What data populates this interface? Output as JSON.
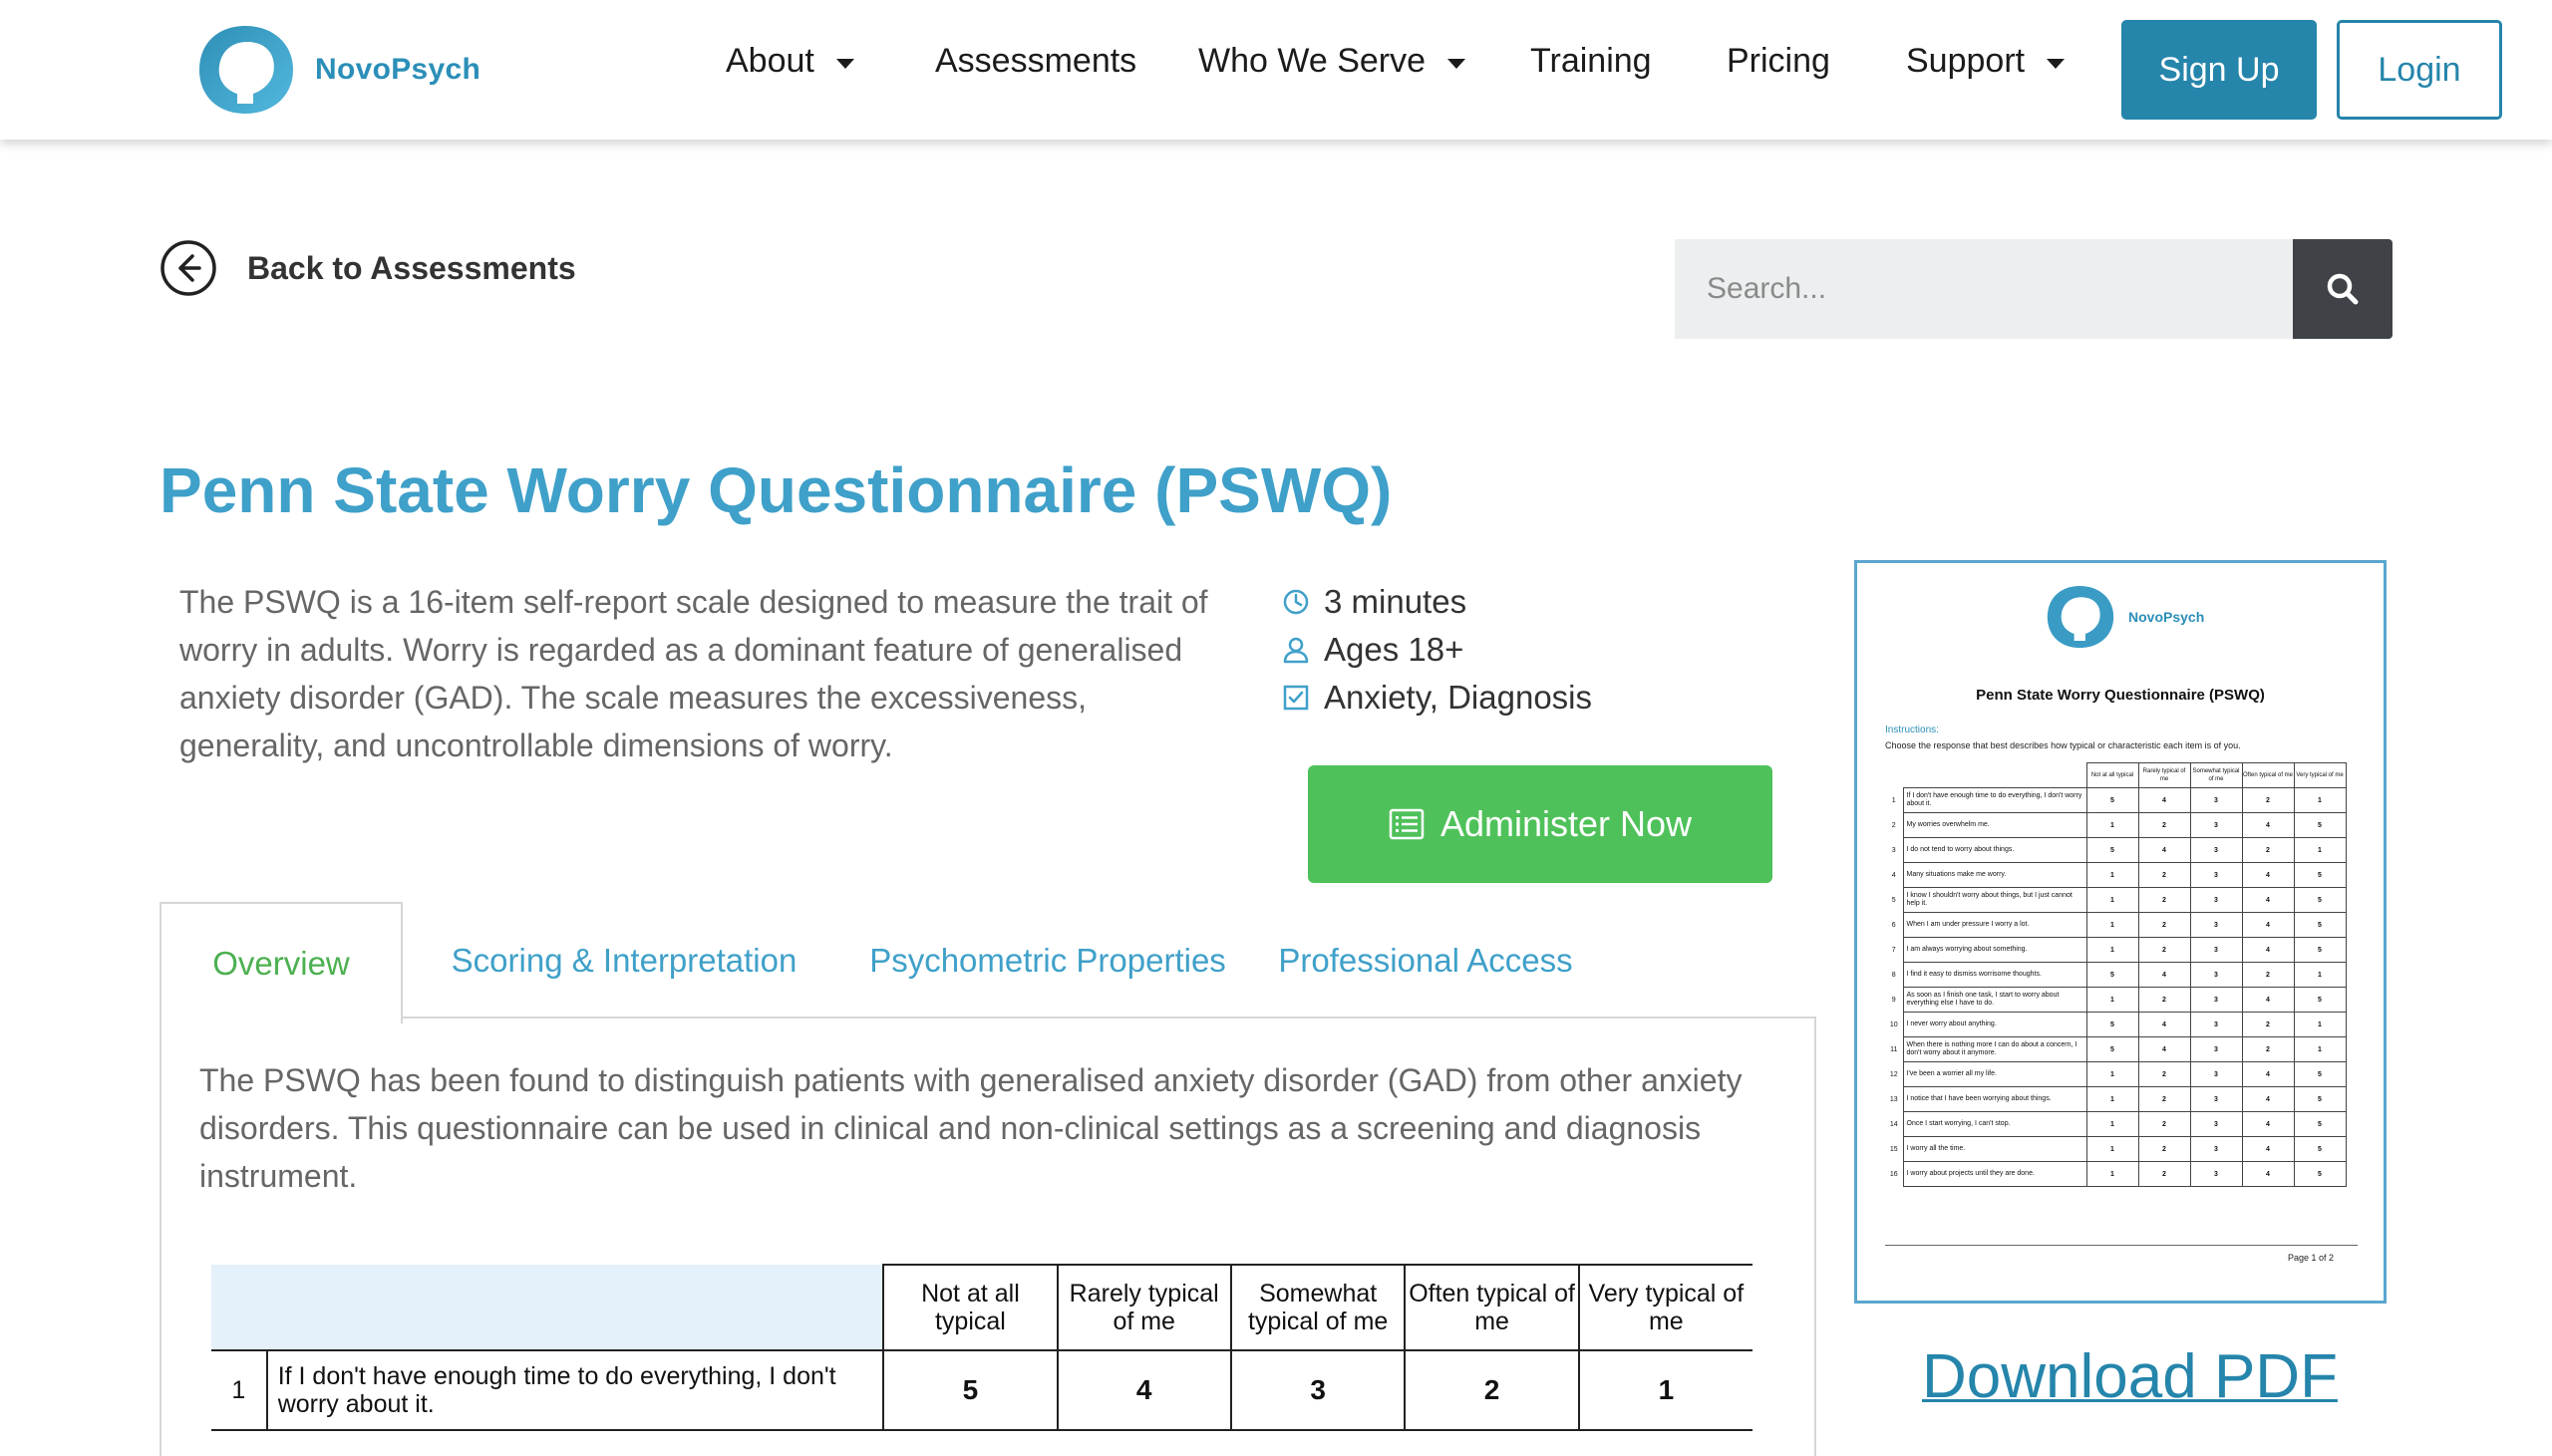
{
  "brand": {
    "name": "NovoPsych",
    "color": "#2b8fb8"
  },
  "nav": {
    "items": [
      {
        "label": "About",
        "dropdown": true
      },
      {
        "label": "Assessments",
        "dropdown": false
      },
      {
        "label": "Who We Serve",
        "dropdown": true
      },
      {
        "label": "Training",
        "dropdown": false
      },
      {
        "label": "Pricing",
        "dropdown": false
      },
      {
        "label": "Support",
        "dropdown": true
      }
    ],
    "signup_label": "Sign Up",
    "login_label": "Login"
  },
  "back_label": "Back to Assessments",
  "search": {
    "placeholder": "Search..."
  },
  "page_title": "Penn State Worry Questionnaire (PSWQ)",
  "description": "The PSWQ is a 16-item self-report scale designed to measure the trait of worry in adults. Worry is regarded as a dominant feature of generalised anxiety disorder (GAD). The scale measures the excessiveness, generality, and uncontrollable dimensions of worry.",
  "meta": {
    "duration": "3 minutes",
    "ages": "Ages 18+",
    "category": "Anxiety, Diagnosis"
  },
  "administer_label": "Administer Now",
  "tabs": [
    {
      "label": "Overview",
      "active": true
    },
    {
      "label": "Scoring & Interpretation",
      "active": false
    },
    {
      "label": "Psychometric Properties",
      "active": false
    },
    {
      "label": "Professional Access",
      "active": false
    }
  ],
  "overview_text": "The PSWQ has been found to distinguish patients with generalised anxiety disorder (GAD) from other anxiety disorders. This questionnaire can be used in clinical and non-clinical settings as a screening and diagnosis instrument.",
  "sample_table": {
    "headers": [
      "Not at all typical",
      "Rarely typical of me",
      "Somewhat typical of me",
      "Often typical of me",
      "Very typical of me"
    ],
    "rows": [
      {
        "num": "1",
        "text": "If I don't have enough time to do everything, I don't worry about it.",
        "scores": [
          "5",
          "4",
          "3",
          "2",
          "1"
        ]
      }
    ]
  },
  "preview": {
    "brand": "NovoPsych",
    "title": "Penn State Worry Questionnaire  (PSWQ)",
    "instructions_label": "Instructions:",
    "instructions": "Choose the response that best describes how typical or characteristic each item is of you.",
    "headers": [
      "Not at all typical",
      "Rarely typical of me",
      "Somewhat typical of me",
      "Often typical of me",
      "Very typical of me"
    ],
    "items": [
      {
        "n": "1",
        "t": "If I don't have enough time to do everything, I don't worry about it.",
        "s": [
          "5",
          "4",
          "3",
          "2",
          "1"
        ]
      },
      {
        "n": "2",
        "t": "My worries overwhelm me.",
        "s": [
          "1",
          "2",
          "3",
          "4",
          "5"
        ]
      },
      {
        "n": "3",
        "t": "I do not tend to worry about things.",
        "s": [
          "5",
          "4",
          "3",
          "2",
          "1"
        ]
      },
      {
        "n": "4",
        "t": "Many situations make me worry.",
        "s": [
          "1",
          "2",
          "3",
          "4",
          "5"
        ]
      },
      {
        "n": "5",
        "t": "I know I shouldn't worry about things, but I just cannot help it.",
        "s": [
          "1",
          "2",
          "3",
          "4",
          "5"
        ]
      },
      {
        "n": "6",
        "t": "When I am under pressure I worry a lot.",
        "s": [
          "1",
          "2",
          "3",
          "4",
          "5"
        ]
      },
      {
        "n": "7",
        "t": "I am always worrying about something.",
        "s": [
          "1",
          "2",
          "3",
          "4",
          "5"
        ]
      },
      {
        "n": "8",
        "t": "I find it easy to dismiss worrisome thoughts.",
        "s": [
          "5",
          "4",
          "3",
          "2",
          "1"
        ]
      },
      {
        "n": "9",
        "t": "As soon as I finish one task, I start to worry about everything else I have to do.",
        "s": [
          "1",
          "2",
          "3",
          "4",
          "5"
        ]
      },
      {
        "n": "10",
        "t": "I never worry about anything.",
        "s": [
          "5",
          "4",
          "3",
          "2",
          "1"
        ]
      },
      {
        "n": "11",
        "t": "When there is nothing more I can do about a concern, I don't worry about it anymore.",
        "s": [
          "5",
          "4",
          "3",
          "2",
          "1"
        ]
      },
      {
        "n": "12",
        "t": "I've been a worrier all my life.",
        "s": [
          "1",
          "2",
          "3",
          "4",
          "5"
        ]
      },
      {
        "n": "13",
        "t": "I notice that I have been worrying about things.",
        "s": [
          "1",
          "2",
          "3",
          "4",
          "5"
        ]
      },
      {
        "n": "14",
        "t": "Once I start worrying, I can't stop.",
        "s": [
          "1",
          "2",
          "3",
          "4",
          "5"
        ]
      },
      {
        "n": "15",
        "t": "I worry all the time.",
        "s": [
          "1",
          "2",
          "3",
          "4",
          "5"
        ]
      },
      {
        "n": "16",
        "t": "I worry about projects until they are done.",
        "s": [
          "1",
          "2",
          "3",
          "4",
          "5"
        ]
      }
    ],
    "page_label": "Page 1 of 2"
  },
  "download_label": "Download PDF",
  "colors": {
    "accent": "#3fa0c9",
    "primary_button": "#2585ab",
    "administer_button": "#4fc15a",
    "active_tab": "#4cb050"
  }
}
